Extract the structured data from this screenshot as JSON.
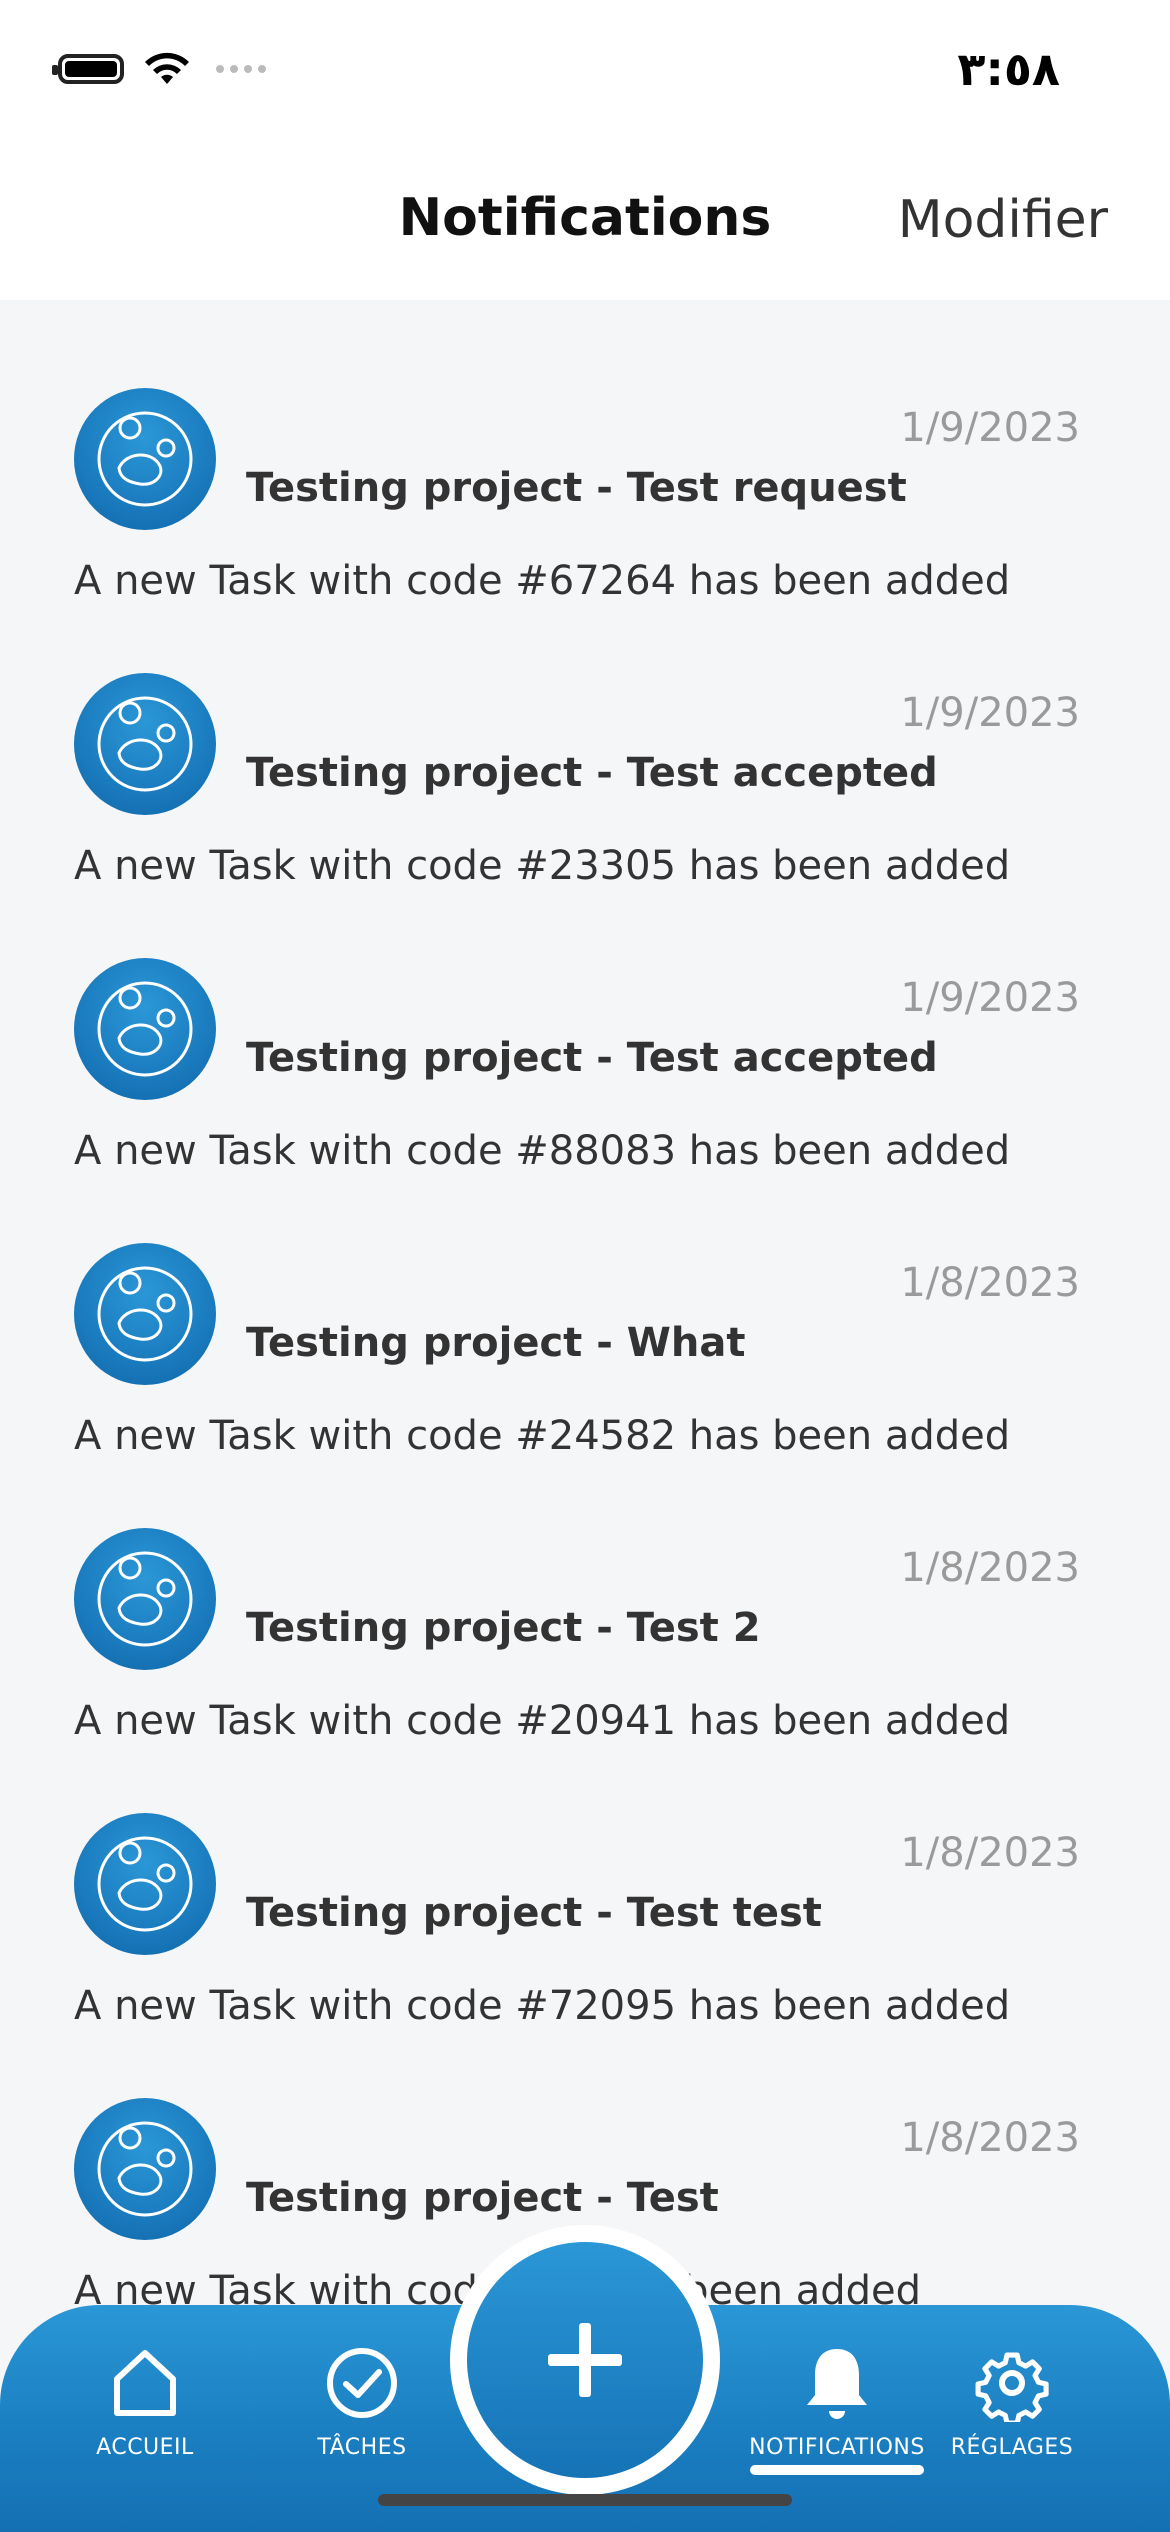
{
  "status_bar": {
    "time": "٣:٥٨"
  },
  "nav": {
    "title": "Notifications",
    "edit_label": "Modifier"
  },
  "notifications": [
    {
      "date": "1/9/2023",
      "title": "Testing project - Test request",
      "message": "A new Task with code #67264 has been added"
    },
    {
      "date": "1/9/2023",
      "title": "Testing project - Test accepted",
      "message": "A new Task with code #23305 has been added"
    },
    {
      "date": "1/9/2023",
      "title": "Testing project - Test accepted",
      "message": "A new Task with code #88083 has been added"
    },
    {
      "date": "1/8/2023",
      "title": "Testing project - What",
      "message": "A new Task with code #24582 has been added"
    },
    {
      "date": "1/8/2023",
      "title": "Testing project - Test 2",
      "message": "A new Task with code #20941 has been added"
    },
    {
      "date": "1/8/2023",
      "title": "Testing project - Test test",
      "message": "A new Task with code #72095 has been added"
    },
    {
      "date": "1/8/2023",
      "title": "Testing project - Test",
      "message": "A new Task with code #... has been added"
    }
  ],
  "tab_bar": {
    "tabs": [
      {
        "label": "ACCUEIL",
        "icon": "home-icon"
      },
      {
        "label": "TÂCHES",
        "icon": "check-circle-icon"
      },
      {
        "label": "NOTIFICATIONS",
        "icon": "bell-icon",
        "active": true
      },
      {
        "label": "RÉGLAGES",
        "icon": "gear-icon"
      }
    ],
    "fab_icon": "plus-icon"
  },
  "colors": {
    "accent": "#1a7fc1",
    "background": "#f5f6f8"
  }
}
